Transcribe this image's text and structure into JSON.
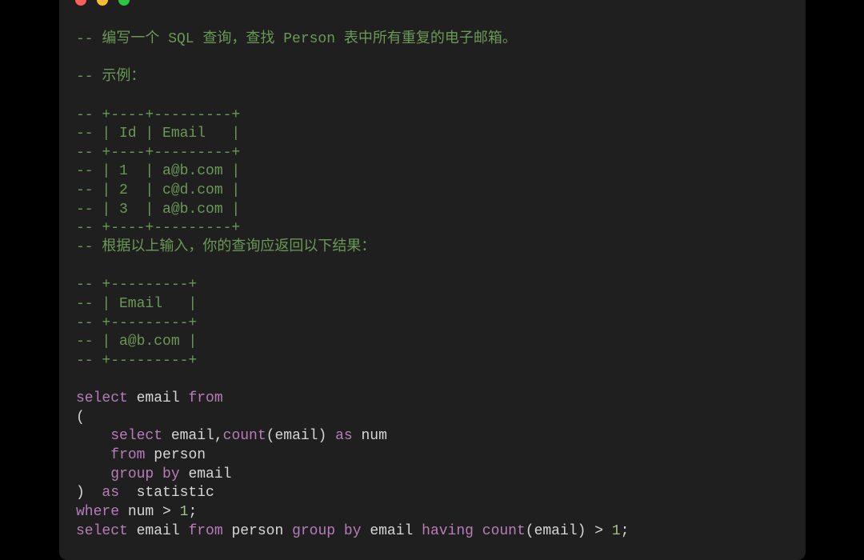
{
  "window": {
    "traffic_lights": [
      {
        "name": "close",
        "color": "#ff5f57"
      },
      {
        "name": "minimize",
        "color": "#febc2e"
      },
      {
        "name": "zoom",
        "color": "#28c840"
      }
    ]
  },
  "colors": {
    "background": "#1f1f1f",
    "comment": "#6a9955",
    "keyword": "#b77db9",
    "text": "#d6d6d6",
    "number": "#a7c48c"
  },
  "code_lines": [
    [
      {
        "t": "c",
        "v": "-- 编写一个 SQL 查询，查找 Person 表中所有重复的电子邮箱。"
      }
    ],
    [],
    [
      {
        "t": "c",
        "v": "-- 示例："
      }
    ],
    [],
    [
      {
        "t": "c",
        "v": "-- +----+---------+"
      }
    ],
    [
      {
        "t": "c",
        "v": "-- | Id | Email   |"
      }
    ],
    [
      {
        "t": "c",
        "v": "-- +----+---------+"
      }
    ],
    [
      {
        "t": "c",
        "v": "-- | 1  | a@b.com |"
      }
    ],
    [
      {
        "t": "c",
        "v": "-- | 2  | c@d.com |"
      }
    ],
    [
      {
        "t": "c",
        "v": "-- | 3  | a@b.com |"
      }
    ],
    [
      {
        "t": "c",
        "v": "-- +----+---------+"
      }
    ],
    [
      {
        "t": "c",
        "v": "-- 根据以上输入，你的查询应返回以下结果："
      }
    ],
    [],
    [
      {
        "t": "c",
        "v": "-- +---------+"
      }
    ],
    [
      {
        "t": "c",
        "v": "-- | Email   |"
      }
    ],
    [
      {
        "t": "c",
        "v": "-- +---------+"
      }
    ],
    [
      {
        "t": "c",
        "v": "-- | a@b.com |"
      }
    ],
    [
      {
        "t": "c",
        "v": "-- +---------+"
      }
    ],
    [],
    [
      {
        "t": "k",
        "v": "select"
      },
      {
        "t": "p",
        "v": " email "
      },
      {
        "t": "k",
        "v": "from"
      }
    ],
    [
      {
        "t": "p",
        "v": "("
      }
    ],
    [
      {
        "t": "p",
        "v": "    "
      },
      {
        "t": "k",
        "v": "select"
      },
      {
        "t": "p",
        "v": " email,"
      },
      {
        "t": "f",
        "v": "count"
      },
      {
        "t": "p",
        "v": "(email) "
      },
      {
        "t": "k",
        "v": "as"
      },
      {
        "t": "p",
        "v": " num"
      }
    ],
    [
      {
        "t": "p",
        "v": "    "
      },
      {
        "t": "k",
        "v": "from"
      },
      {
        "t": "p",
        "v": " person"
      }
    ],
    [
      {
        "t": "p",
        "v": "    "
      },
      {
        "t": "k",
        "v": "group"
      },
      {
        "t": "p",
        "v": " "
      },
      {
        "t": "k",
        "v": "by"
      },
      {
        "t": "p",
        "v": " email"
      }
    ],
    [
      {
        "t": "p",
        "v": ")  "
      },
      {
        "t": "k",
        "v": "as"
      },
      {
        "t": "p",
        "v": "  statistic"
      }
    ],
    [
      {
        "t": "k",
        "v": "where"
      },
      {
        "t": "p",
        "v": " num > "
      },
      {
        "t": "n",
        "v": "1"
      },
      {
        "t": "p",
        "v": ";"
      }
    ],
    [
      {
        "t": "k",
        "v": "select"
      },
      {
        "t": "p",
        "v": " email "
      },
      {
        "t": "k",
        "v": "from"
      },
      {
        "t": "p",
        "v": " person "
      },
      {
        "t": "k",
        "v": "group"
      },
      {
        "t": "p",
        "v": " "
      },
      {
        "t": "k",
        "v": "by"
      },
      {
        "t": "p",
        "v": " email "
      },
      {
        "t": "k",
        "v": "having"
      },
      {
        "t": "p",
        "v": " "
      },
      {
        "t": "f",
        "v": "count"
      },
      {
        "t": "p",
        "v": "(email) > "
      },
      {
        "t": "n",
        "v": "1"
      },
      {
        "t": "p",
        "v": ";"
      }
    ]
  ]
}
